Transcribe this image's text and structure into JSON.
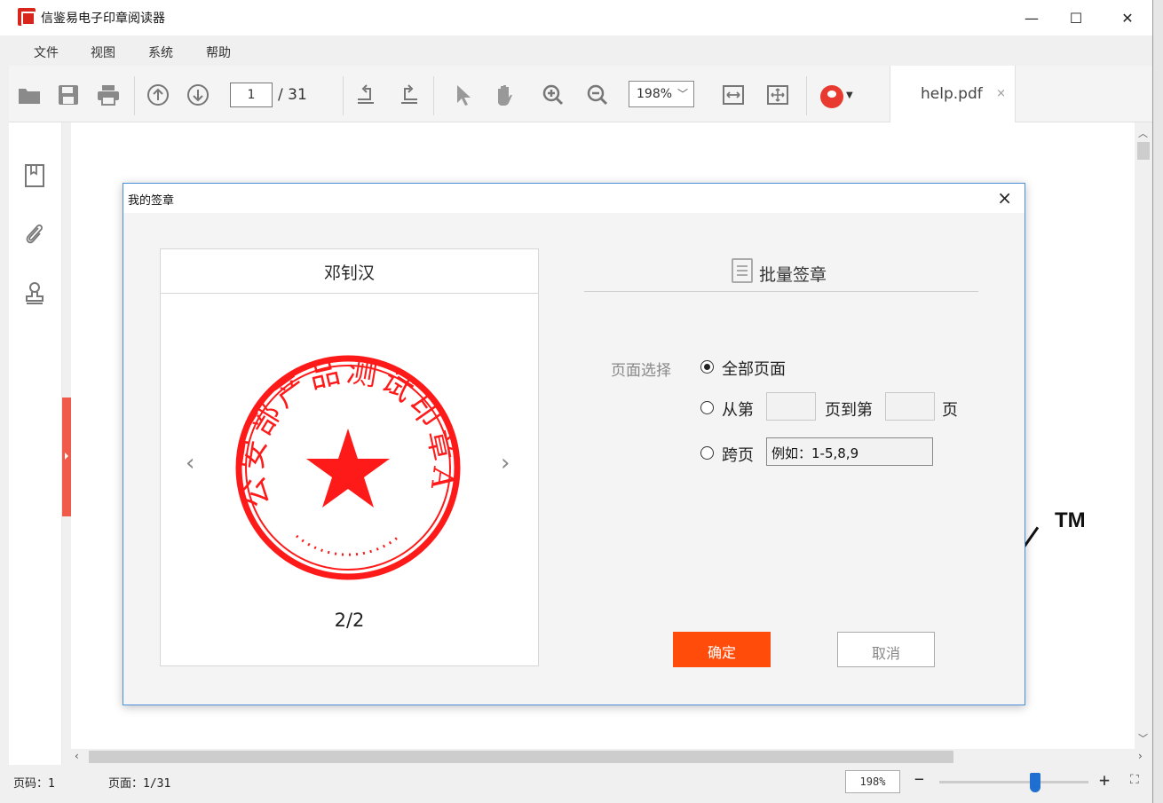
{
  "app": {
    "title": "信鉴易电子印章阅读器"
  },
  "menu": {
    "items": [
      "文件",
      "视图",
      "系统",
      "帮助"
    ]
  },
  "toolbar": {
    "current_page": "1",
    "total_pages": "/ 31",
    "zoom": "198%"
  },
  "tab": {
    "label": "help.pdf",
    "close": "×"
  },
  "document": {
    "trademark": "TM"
  },
  "dialog": {
    "title": "我的签章",
    "close": "×",
    "seal_owner": "邓钊汉",
    "seal_text": "公安部产品测试印章A",
    "seal_counter": "2/2",
    "prev": "‹",
    "next": "›",
    "batch_title": "批量签章",
    "page_select_label": "页面选择",
    "opt_all": "全部页面",
    "opt_range_from": "从第",
    "opt_range_to": "页到第",
    "opt_range_unit": "页",
    "opt_cross": "跨页",
    "cross_placeholder": "例如：1-5,8,9",
    "ok": "确定",
    "cancel": "取消"
  },
  "status": {
    "page_code": "页码：1",
    "page_info": "页面：1/31",
    "zoom": "198%"
  }
}
